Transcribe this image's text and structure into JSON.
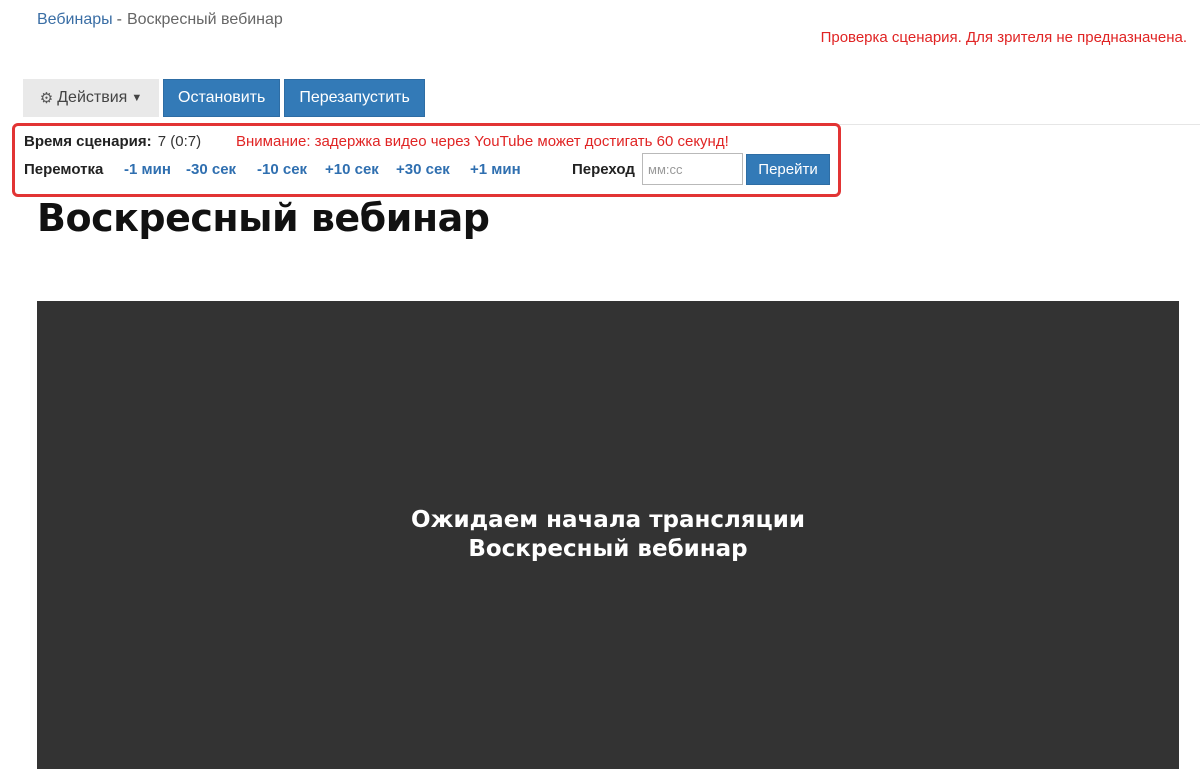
{
  "breadcrumb": {
    "parent": "Вебинары",
    "separator": "-",
    "current": "Воскресный вебинар"
  },
  "preview_note": "Проверка сценария. Для зрителя не предназначена.",
  "toolbar": {
    "actions_label": "Действия",
    "actions_icon": "gears-icon",
    "stop_label": "Остановить",
    "restart_label": "Перезапустить"
  },
  "scenario": {
    "time_label": "Время сценария:",
    "time_value": "7 (0:7)",
    "warning": "Внимание: задержка видео через YouTube может достигать 60 секунд!"
  },
  "rewind": {
    "label": "Перемотка",
    "buttons": [
      "-1 мин",
      "-30 сек",
      "-10 сек",
      "+10 сек",
      "+30 сек",
      "+1 мин"
    ]
  },
  "goto": {
    "label": "Переход",
    "placeholder": "мм:сс",
    "button_label": "Перейти"
  },
  "page_title": "Воскресный вебинар",
  "player": {
    "line1": "Ожидаем начала трансляции",
    "line2": "Воскресный вебинар"
  },
  "colors": {
    "primary": "#337ab7",
    "alert": "#e02424",
    "player_bg": "#333333"
  }
}
